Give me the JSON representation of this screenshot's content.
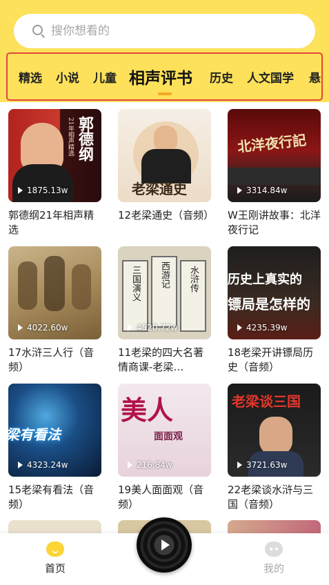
{
  "search": {
    "placeholder": "搜你想看的"
  },
  "categories": {
    "tabs": [
      "精选",
      "小说",
      "儿童",
      "相声评书",
      "历史",
      "人文国学",
      "悬"
    ],
    "active_index": 3
  },
  "colors": {
    "header": "#fde15a",
    "accent": "#f5a623",
    "highlight_border": "#e2463b"
  },
  "albums": [
    {
      "title": "郭德纲21年相声精选",
      "plays": "1875.13w",
      "thumb_text": "郭德纲",
      "thumb_sub": "21年相声精选"
    },
    {
      "title": "12老梁通史（音频）",
      "plays": "",
      "thumb_text": "老梁通史"
    },
    {
      "title": "W王刚讲故事：北洋夜行记",
      "plays": "3314.84w",
      "thumb_text": "北洋夜行記"
    },
    {
      "title": "17水浒三人行（音频）",
      "plays": "4022.60w",
      "thumb_text": ""
    },
    {
      "title": "11老梁的四大名著情商课-老梁…",
      "plays": "4520.72w",
      "thumb_text": "三国演义",
      "thumb_text2": "西游记",
      "thumb_text3": "水浒传"
    },
    {
      "title": "18老梁开讲镖局历史（音频）",
      "plays": "4235.39w",
      "thumb_text": "历史上真实的",
      "thumb_text2": "镖局是怎样的"
    },
    {
      "title": "15老梁有看法（音频）",
      "plays": "4323.24w",
      "thumb_text": "梁有看法"
    },
    {
      "title": "19美人面面观（音频）",
      "plays": "216.84w",
      "thumb_text": "美人",
      "thumb_text2": "面面观"
    },
    {
      "title": "22老梁谈水浒与三国（音频）",
      "plays": "3721.63w",
      "thumb_text": "老梁谈三国"
    }
  ],
  "nav": {
    "home_label": "首页",
    "mine_label": "我的"
  }
}
